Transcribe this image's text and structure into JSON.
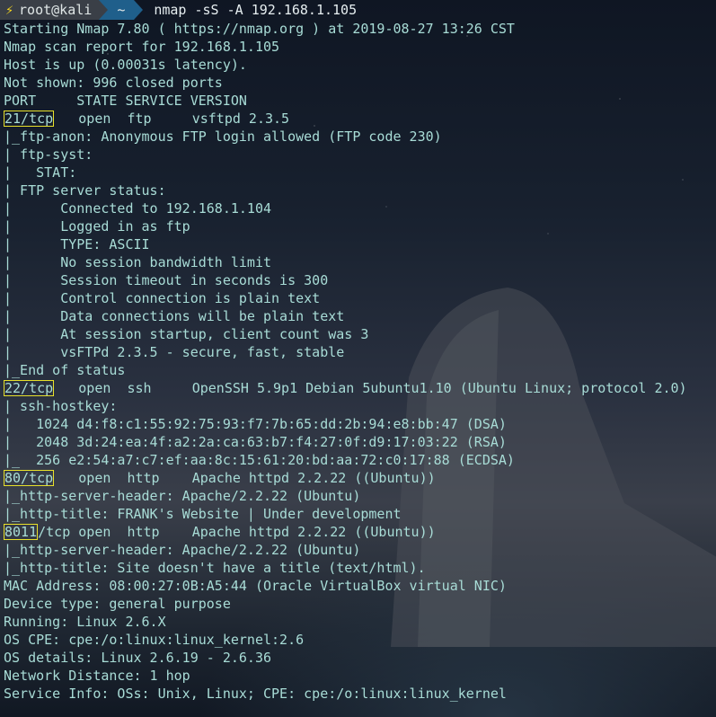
{
  "prompt": {
    "user": "root@kali",
    "dir": "~",
    "command": "nmap -sS -A 192.168.1.105"
  },
  "lines": {
    "l1": "Starting Nmap 7.80 ( https://nmap.org ) at 2019-08-27 13:26 CST",
    "l2": "Nmap scan report for 192.168.1.105",
    "l3": "Host is up (0.00031s latency).",
    "l4": "Not shown: 996 closed ports",
    "l5": "PORT     STATE SERVICE VERSION",
    "p21_port": "21/tcp",
    "p21_rest": "   open  ftp     vsftpd 2.3.5",
    "l7": "|_ftp-anon: Anonymous FTP login allowed (FTP code 230)",
    "l8": "| ftp-syst:",
    "l9": "|   STAT:",
    "l10": "| FTP server status:",
    "l11": "|      Connected to 192.168.1.104",
    "l12": "|      Logged in as ftp",
    "l13": "|      TYPE: ASCII",
    "l14": "|      No session bandwidth limit",
    "l15": "|      Session timeout in seconds is 300",
    "l16": "|      Control connection is plain text",
    "l17": "|      Data connections will be plain text",
    "l18": "|      At session startup, client count was 3",
    "l19": "|      vsFTPd 2.3.5 - secure, fast, stable",
    "l20": "|_End of status",
    "p22_port": "22/tcp",
    "p22_rest": "   open  ssh     OpenSSH 5.9p1 Debian 5ubuntu1.10 (Ubuntu Linux; protocol 2.0)",
    "l22": "| ssh-hostkey:",
    "l23": "|   1024 d4:f8:c1:55:92:75:93:f7:7b:65:dd:2b:94:e8:bb:47 (DSA)",
    "l24": "|   2048 3d:24:ea:4f:a2:2a:ca:63:b7:f4:27:0f:d9:17:03:22 (RSA)",
    "l25": "|_  256 e2:54:a7:c7:ef:aa:8c:15:61:20:bd:aa:72:c0:17:88 (ECDSA)",
    "p80_port": "80/tcp",
    "p80_rest": "   open  http    Apache httpd 2.2.22 ((Ubuntu))",
    "l27": "|_http-server-header: Apache/2.2.22 (Ubuntu)",
    "l28": "|_http-title: FRANK's Website | Under development",
    "p8011_port": "8011",
    "p8011_rest": "/tcp open  http    Apache httpd 2.2.22 ((Ubuntu))",
    "l30": "|_http-server-header: Apache/2.2.22 (Ubuntu)",
    "l31": "|_http-title: Site doesn't have a title (text/html).",
    "l32": "MAC Address: 08:00:27:0B:A5:44 (Oracle VirtualBox virtual NIC)",
    "l33": "Device type: general purpose",
    "l34": "Running: Linux 2.6.X",
    "l35": "OS CPE: cpe:/o:linux:linux_kernel:2.6",
    "l36": "OS details: Linux 2.6.19 - 2.6.36",
    "l37": "Network Distance: 1 hop",
    "l38": "Service Info: OSs: Unix, Linux; CPE: cpe:/o:linux:linux_kernel"
  },
  "colors": {
    "text": "#a8dcd6",
    "highlight": "#e8e12a",
    "prompt_user_bg": "#3a3f47",
    "prompt_dir_bg": "#1f5f8b"
  }
}
